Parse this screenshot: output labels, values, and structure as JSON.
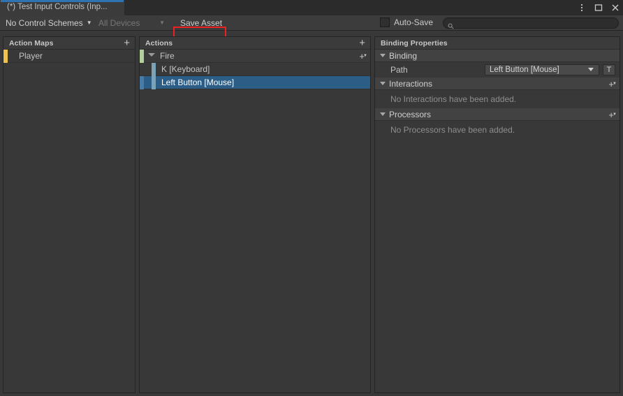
{
  "window": {
    "tab_title": "(*) Test Input Controls (Inp...",
    "menu_icon": "kebab-menu-icon",
    "maximize_icon": "maximize-icon",
    "close_icon": "close-icon",
    "tab_accent_color": "#2f73b3"
  },
  "toolbar": {
    "control_schemes_label": "No Control Schemes",
    "devices_label": "All Devices",
    "save_asset_label": "Save Asset",
    "autosave_label": "Auto-Save",
    "autosave_checked": false,
    "search_placeholder": "",
    "search_value": "",
    "search_icon": "search-icon",
    "highlight_color": "#ef2020",
    "highlight_target": "Save Asset"
  },
  "action_maps": {
    "header": "Action Maps",
    "add_label": "+",
    "items": [
      {
        "label": "Player",
        "accent_color": "#f0c14b",
        "selected": false
      }
    ]
  },
  "actions": {
    "header": "Actions",
    "add_label": "+",
    "tree": [
      {
        "label": "Fire",
        "type": "action",
        "expanded": true,
        "accent_color": "#b2d09a",
        "add_label": "+",
        "children": [
          {
            "label": "K [Keyboard]",
            "type": "binding",
            "accent_color": "#7aa3b8",
            "selected": false
          },
          {
            "label": "Left Button [Mouse]",
            "type": "binding",
            "accent_color": "#7aa3b8",
            "selected": true
          }
        ]
      }
    ],
    "selection_color": "#2c5d87"
  },
  "binding_properties": {
    "header": "Binding Properties",
    "sections": [
      {
        "title": "Binding",
        "expanded": true,
        "has_add": false,
        "path_label": "Path",
        "path_value": "Left Button [Mouse]",
        "t_button_label": "T"
      },
      {
        "title": "Interactions",
        "expanded": true,
        "has_add": true,
        "add_label": "+",
        "empty_message": "No Interactions have been added."
      },
      {
        "title": "Processors",
        "expanded": true,
        "has_add": true,
        "add_label": "+",
        "empty_message": "No Processors have been added."
      }
    ]
  }
}
